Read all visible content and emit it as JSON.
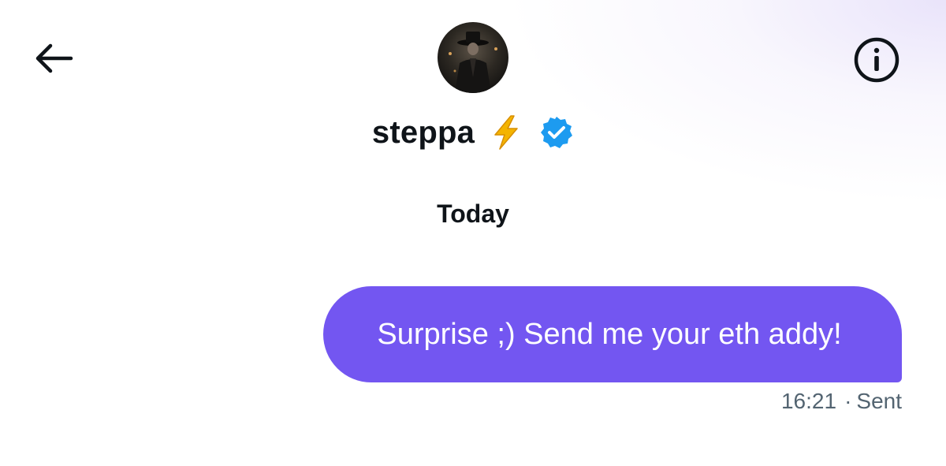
{
  "header": {
    "back_icon": "arrow-left-icon",
    "info_icon": "info-circle-icon",
    "avatar_alt": "profile photo"
  },
  "profile": {
    "name": "steppa",
    "emoji_icon": "lightning-bolt-icon",
    "verified_icon": "verified-badge-icon"
  },
  "conversation": {
    "date_separator": "Today",
    "messages": [
      {
        "text": "Surprise ;) Send me your eth addy!",
        "time": "16:21",
        "status": "Sent"
      }
    ]
  },
  "colors": {
    "bubble": "#7356f1",
    "verified": "#1d9bf0",
    "bolt": "#f4b400",
    "meta_text": "#536471"
  }
}
